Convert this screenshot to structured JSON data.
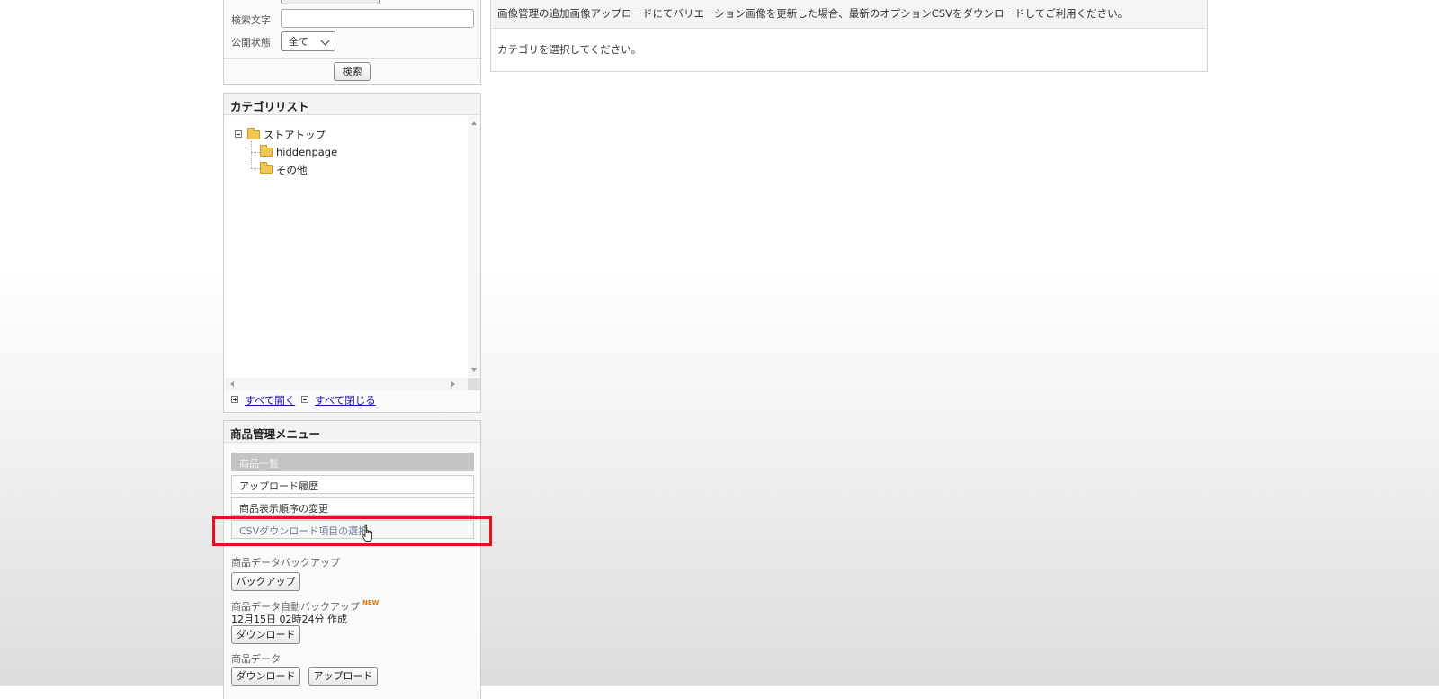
{
  "search": {
    "keyword_label": "検索文字",
    "keyword_value": "",
    "status_label": "公開状態",
    "status_selected": "全て",
    "search_button": "検索"
  },
  "category": {
    "title": "カテゴリリスト",
    "root": "ストアトップ",
    "children": [
      "hiddenpage",
      "その他"
    ],
    "expand_all": "すべて開く",
    "collapse_all": "すべて閉じる"
  },
  "menu": {
    "title": "商品管理メニュー",
    "items": [
      "商品一覧",
      "アップロード履歴",
      "商品表示順序の変更",
      "CSVダウンロード項目の選択"
    ],
    "backup_label": "商品データバックアップ",
    "backup_button": "バックアップ",
    "auto_backup_label": "商品データ自動バックアップ",
    "new_badge": "NEW",
    "auto_backup_time": "12月15日 02時24分 作成",
    "auto_download_button": "ダウンロード",
    "data_label": "商品データ",
    "data_download_button": "ダウンロード",
    "data_upload_button": "アップロード"
  },
  "content": {
    "notice": "画像管理の追加画像アップロードにてバリエーション画像を更新した場合、最新のオプションCSVをダウンロードしてご利用ください。",
    "message": "カテゴリを選択してください。"
  },
  "colors": {
    "highlight_box": "#e3121c",
    "active_menu_bg": "#c3c3c3",
    "link": "#1a0dab",
    "new_badge": "#e07b00"
  }
}
